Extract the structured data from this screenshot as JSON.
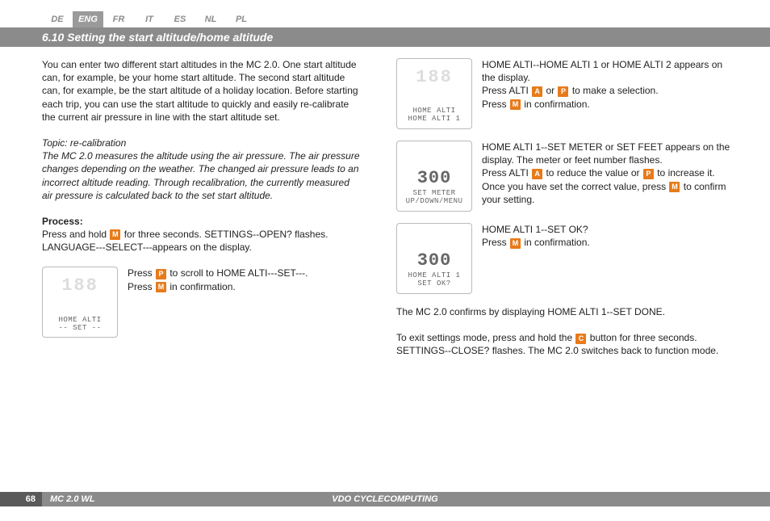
{
  "languages": [
    "DE",
    "ENG",
    "FR",
    "IT",
    "ES",
    "NL",
    "PL"
  ],
  "active_lang_index": 1,
  "title": "6.10 Setting the start altitude/home altitude",
  "intro": "You can enter two different start altitudes in the MC 2.0. One start altitude can, for example, be your home start altitude. The second start altitude can, for example, be the start altitude of a holiday location. Before starting each trip, you can use the start altitude to quickly and easily re-calibrate the current air pressure in line with the start altitude set.",
  "topic_label": "Topic: re-calibration",
  "topic_body": "The MC 2.0 measures the altitude using the air pressure. The air pressure changes depending on the weather. The changed air pressure leads to an incorrect altitude reading. Through recalibration, the currently measured air pressure is calculated back to the set start altitude.",
  "process_label": "Process:",
  "process_line1a": "Press and hold ",
  "process_line1b": " for three seconds. SETTINGS--OPEN? flashes. LANGUAGE---SELECT---appears on the display.",
  "step1a": "Press ",
  "step1b": " to scroll to HOME ALTI---SET---.",
  "step1c": "Press ",
  "step1d": " in confirmation.",
  "r1a": "HOME ALTI--HOME ALTI 1 or HOME ALTI 2 appears on the display.",
  "r1b": "Press ALTI ",
  "r1c": " or ",
  "r1d": " to make a selection.",
  "r1e": "Press ",
  "r1f": " in confirmation.",
  "r2a": "HOME ALTI 1--SET METER or SET FEET appears on the display. The meter or feet number flashes.",
  "r2b": "Press ALTI ",
  "r2c": " to reduce the value or ",
  "r2d": " to increase it. Once you have set the correct value, press ",
  "r2e": " to confirm your setting.",
  "r3a": "HOME ALTI 1--SET OK?",
  "r3b": "Press ",
  "r3c": " in confirmation.",
  "confirm": "The MC 2.0 confirms by displaying HOME ALTI 1--SET DONE.",
  "exit_a": "To exit settings mode, press and hold the ",
  "exit_b": " button for three seconds. SETTINGS--CLOSE? flashes. The MC 2.0 switches back to function mode.",
  "lcd1_l1": "HOME ALTI",
  "lcd1_l2": "-- SET --",
  "lcd2_l1": "HOME ALTI",
  "lcd2_l2": "HOME ALTI 1",
  "lcd3_v": "300",
  "lcd3_l1": "SET METER",
  "lcd3_l2": "UP/DOWN/MENU",
  "lcd4_v": "300",
  "lcd4_l1": "HOME ALTI 1",
  "lcd4_l2": "SET OK?",
  "btn_M": "M",
  "btn_P": "P",
  "btn_A": "A",
  "btn_C": "C",
  "page_num": "68",
  "model": "MC 2.0 WL",
  "brand": "VDO CYCLECOMPUTING"
}
